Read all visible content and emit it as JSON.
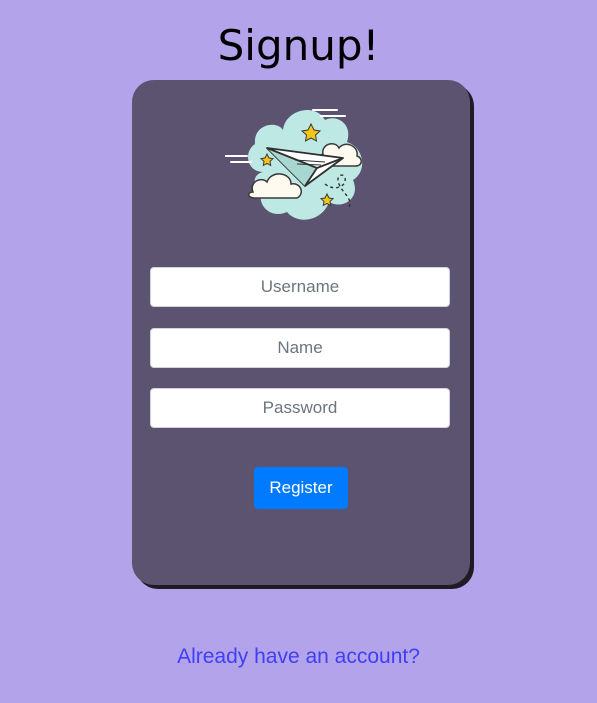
{
  "page": {
    "title": "Signup!"
  },
  "form": {
    "username_placeholder": "Username",
    "username_value": "",
    "name_placeholder": "Name",
    "name_value": "",
    "password_placeholder": "Password",
    "password_value": "",
    "register_label": "Register"
  },
  "footer": {
    "login_link": "Already have an account?"
  },
  "icons": {
    "illustration": "paper-plane-clouds-icon"
  },
  "colors": {
    "background": "#b3a3ea",
    "card": "#5c5370",
    "button": "#007bff",
    "link": "#3f3ff5"
  }
}
